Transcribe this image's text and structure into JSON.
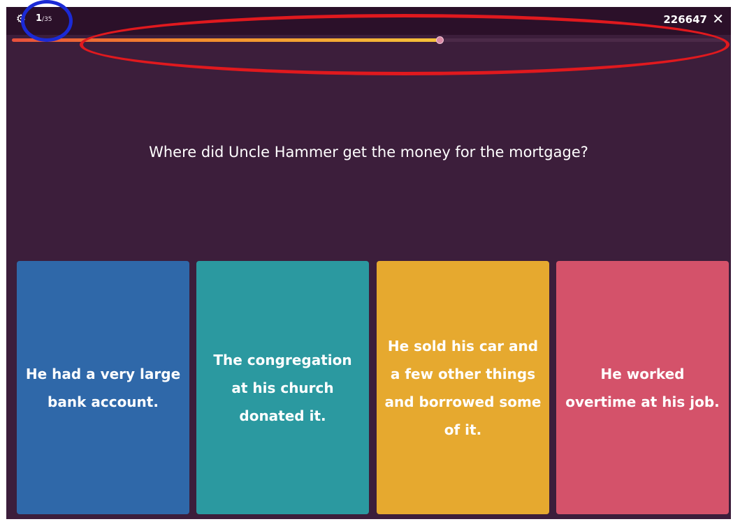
{
  "topbar": {
    "counter_current": "1",
    "counter_total": "/35",
    "game_code": "226647",
    "settings_icon": "gear-icon",
    "close_icon": "close-icon"
  },
  "progress": {
    "fraction": 0.6,
    "colors": [
      "#e8503c",
      "#f28a2c",
      "#f5c23a"
    ]
  },
  "question": {
    "text": "Where did Uncle Hammer get the money for the mortgage?"
  },
  "answers": [
    {
      "text": "He had a very large bank account.",
      "color": "#2f68a9"
    },
    {
      "text": "The congregation at his church donated it.",
      "color": "#2b99a0"
    },
    {
      "text": "He sold his car and a few other things and borrowed some of it.",
      "color": "#e6a92f"
    },
    {
      "text": "He worked overtime at his job.",
      "color": "#d4526a"
    }
  ],
  "annotations": {
    "blue_circle_color": "#1b2ad6",
    "red_ellipse_color": "#e0191e"
  }
}
